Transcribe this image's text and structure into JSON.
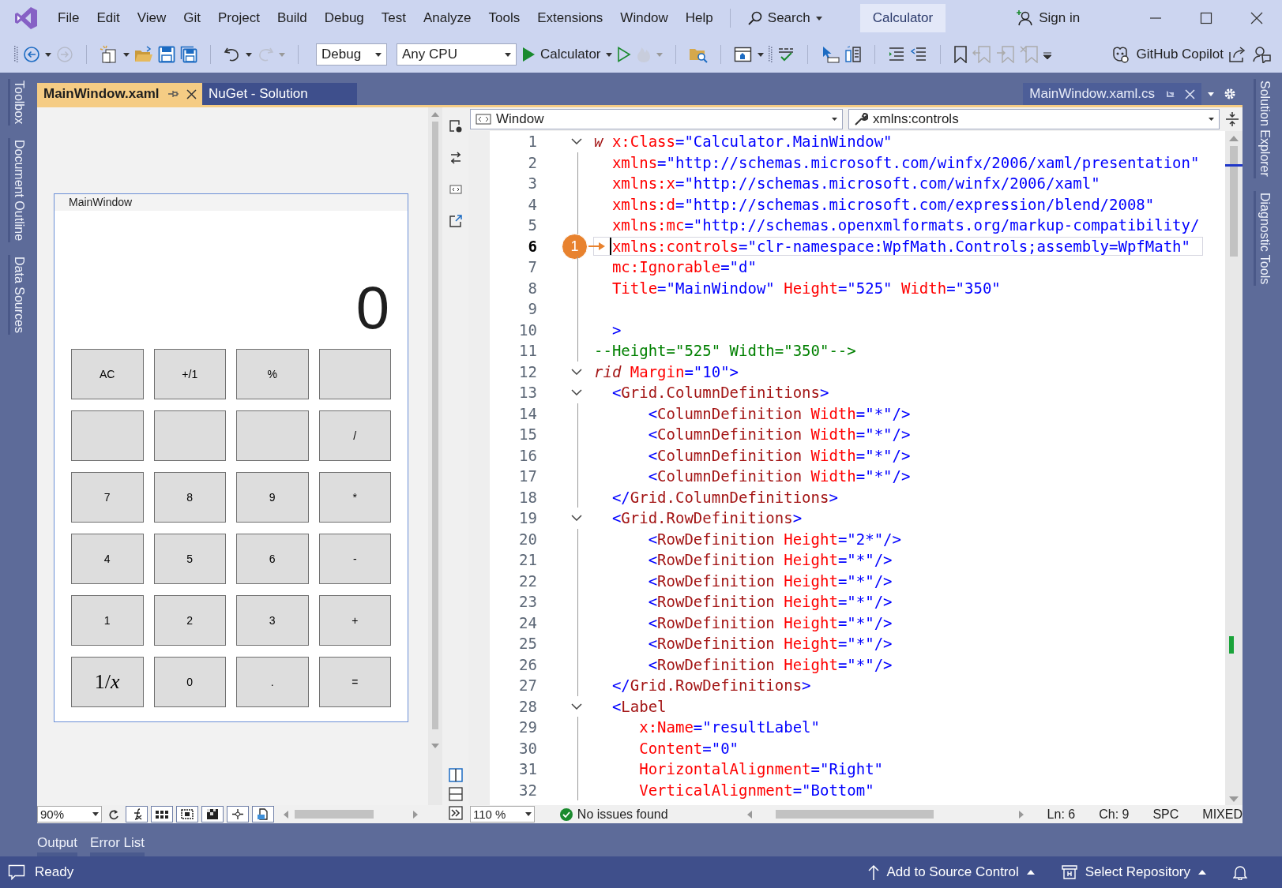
{
  "window": {
    "badge": "Calculator"
  },
  "menu": [
    "File",
    "Edit",
    "View",
    "Git",
    "Project",
    "Build",
    "Debug",
    "Test",
    "Analyze",
    "Tools",
    "Extensions",
    "Window",
    "Help"
  ],
  "search": {
    "label": "Search"
  },
  "account": {
    "label": "Sign in"
  },
  "toolbar": {
    "configuration": "Debug",
    "platform": "Any CPU",
    "start_target": "Calculator",
    "copilot": "GitHub Copilot"
  },
  "left_tool_tabs": [
    "Toolbox",
    "Document Outline",
    "Data Sources"
  ],
  "right_tool_tabs": [
    "Solution Explorer",
    "Diagnostic Tools"
  ],
  "document_tabs": [
    {
      "label": "MainWindow.xaml",
      "selected": true
    },
    {
      "label": "NuGet - Solution",
      "selected": false
    }
  ],
  "preview_tab": {
    "label": "MainWindow.xaml.cs"
  },
  "designer": {
    "window_title": "MainWindow",
    "display": "0",
    "zoom": "90%",
    "buttons": [
      {
        "kind": "text",
        "label": "AC"
      },
      {
        "kind": "text",
        "label": "+/1"
      },
      {
        "kind": "text",
        "label": "%"
      },
      {
        "kind": "blank"
      },
      {
        "kind": "blank"
      },
      {
        "kind": "blank"
      },
      {
        "kind": "blank"
      },
      {
        "kind": "text",
        "label": "/"
      },
      {
        "kind": "text",
        "label": "7"
      },
      {
        "kind": "text",
        "label": "8"
      },
      {
        "kind": "text",
        "label": "9"
      },
      {
        "kind": "text",
        "label": "*"
      },
      {
        "kind": "text",
        "label": "4"
      },
      {
        "kind": "text",
        "label": "5"
      },
      {
        "kind": "text",
        "label": "6"
      },
      {
        "kind": "text",
        "label": "-"
      },
      {
        "kind": "text",
        "label": "1"
      },
      {
        "kind": "text",
        "label": "2"
      },
      {
        "kind": "text",
        "label": "3"
      },
      {
        "kind": "text",
        "label": "+"
      },
      {
        "kind": "math",
        "label": "1/*x*"
      },
      {
        "kind": "text",
        "label": "0"
      },
      {
        "kind": "text",
        "label": "."
      },
      {
        "kind": "text",
        "label": "="
      }
    ]
  },
  "editor": {
    "type_combo": "Window",
    "member_combo": "xmlns:controls",
    "callout": "1",
    "zoom": "110 %",
    "issues": "No issues found",
    "line": "Ln: 6",
    "column": "Ch: 9",
    "whitespace": "SPC",
    "line_endings": "MIXED",
    "lines": [
      {
        "number": "1",
        "foldable": true,
        "current": false,
        "segments": [
          {
            "kind": "tag",
            "text": "w"
          },
          {
            "kind": "attr",
            "text": " x:Class"
          },
          {
            "kind": "value",
            "text": "=\"Calculator.MainWindow\""
          }
        ]
      },
      {
        "number": "2",
        "foldable": false,
        "current": false,
        "segments": [
          {
            "kind": "attr",
            "text": "  xmlns"
          },
          {
            "kind": "value",
            "text": "=\"http://schemas.microsoft.com/winfx/2006/xaml/presentation\""
          }
        ]
      },
      {
        "number": "3",
        "foldable": false,
        "current": false,
        "segments": [
          {
            "kind": "attr",
            "text": "  xmlns:x"
          },
          {
            "kind": "value",
            "text": "=\"http://schemas.microsoft.com/winfx/2006/xaml\""
          }
        ]
      },
      {
        "number": "4",
        "foldable": false,
        "current": false,
        "segments": [
          {
            "kind": "attr",
            "text": "  xmlns:d"
          },
          {
            "kind": "value",
            "text": "=\"http://schemas.microsoft.com/expression/blend/2008\""
          }
        ]
      },
      {
        "number": "5",
        "foldable": false,
        "current": false,
        "segments": [
          {
            "kind": "attr",
            "text": "  xmlns:mc"
          },
          {
            "kind": "value",
            "text": "=\"http://schemas.openxmlformats.org/markup-compatibility/"
          }
        ]
      },
      {
        "number": "6",
        "foldable": false,
        "current": true,
        "segments": [
          {
            "kind": "attr",
            "text": "  xmlns:controls"
          },
          {
            "kind": "value",
            "text": "=\"clr-namespace:WpfMath.Controls;assembly=WpfMath\""
          }
        ]
      },
      {
        "number": "7",
        "foldable": false,
        "current": false,
        "segments": [
          {
            "kind": "attr",
            "text": "  mc:Ignorable"
          },
          {
            "kind": "value",
            "text": "=\"d\""
          }
        ]
      },
      {
        "number": "8",
        "foldable": false,
        "current": false,
        "segments": [
          {
            "kind": "attr",
            "text": "  Title"
          },
          {
            "kind": "value",
            "text": "=\"MainWindow\""
          },
          {
            "kind": "attr",
            "text": " Height"
          },
          {
            "kind": "value",
            "text": "=\"525\""
          },
          {
            "kind": "attr",
            "text": " Width"
          },
          {
            "kind": "value",
            "text": "=\"350\""
          }
        ]
      },
      {
        "number": "9",
        "foldable": false,
        "current": false
      },
      {
        "number": "10",
        "foldable": false,
        "current": false,
        "segments": [
          {
            "kind": "punct",
            "text": "  >"
          }
        ]
      },
      {
        "number": "11",
        "foldable": false,
        "current": false,
        "segments": [
          {
            "kind": "comment",
            "text": "--Height=\"525\" Width=\"350\"-->"
          }
        ]
      },
      {
        "number": "12",
        "foldable": true,
        "current": false,
        "segments": [
          {
            "kind": "tag",
            "text": "rid"
          },
          {
            "kind": "attr",
            "text": " Margin"
          },
          {
            "kind": "value",
            "text": "=\"10\""
          },
          {
            "kind": "punct",
            "text": ">"
          }
        ]
      },
      {
        "number": "13",
        "foldable": true,
        "current": false,
        "segments": [
          {
            "kind": "punct",
            "text": "  <"
          },
          {
            "kind": "tag",
            "text": "Grid.ColumnDefinitions"
          },
          {
            "kind": "punct",
            "text": ">"
          }
        ]
      },
      {
        "number": "14",
        "foldable": false,
        "current": false,
        "segments": [
          {
            "kind": "punct",
            "text": "      <"
          },
          {
            "kind": "tag",
            "text": "ColumnDefinition"
          },
          {
            "kind": "attr",
            "text": " Width"
          },
          {
            "kind": "value",
            "text": "=\"*\""
          },
          {
            "kind": "punct",
            "text": "/>"
          }
        ]
      },
      {
        "number": "15",
        "foldable": false,
        "current": false,
        "segments": [
          {
            "kind": "punct",
            "text": "      <"
          },
          {
            "kind": "tag",
            "text": "ColumnDefinition"
          },
          {
            "kind": "attr",
            "text": " Width"
          },
          {
            "kind": "value",
            "text": "=\"*\""
          },
          {
            "kind": "punct",
            "text": "/>"
          }
        ]
      },
      {
        "number": "16",
        "foldable": false,
        "current": false,
        "segments": [
          {
            "kind": "punct",
            "text": "      <"
          },
          {
            "kind": "tag",
            "text": "ColumnDefinition"
          },
          {
            "kind": "attr",
            "text": " Width"
          },
          {
            "kind": "value",
            "text": "=\"*\""
          },
          {
            "kind": "punct",
            "text": "/>"
          }
        ]
      },
      {
        "number": "17",
        "foldable": false,
        "current": false,
        "segments": [
          {
            "kind": "punct",
            "text": "      <"
          },
          {
            "kind": "tag",
            "text": "ColumnDefinition"
          },
          {
            "kind": "attr",
            "text": " Width"
          },
          {
            "kind": "value",
            "text": "=\"*\""
          },
          {
            "kind": "punct",
            "text": "/>"
          }
        ]
      },
      {
        "number": "18",
        "foldable": false,
        "current": false,
        "segments": [
          {
            "kind": "punct",
            "text": "  </"
          },
          {
            "kind": "tag",
            "text": "Grid.ColumnDefinitions"
          },
          {
            "kind": "punct",
            "text": ">"
          }
        ]
      },
      {
        "number": "19",
        "foldable": true,
        "current": false,
        "segments": [
          {
            "kind": "punct",
            "text": "  <"
          },
          {
            "kind": "tag",
            "text": "Grid.RowDefinitions"
          },
          {
            "kind": "punct",
            "text": ">"
          }
        ]
      },
      {
        "number": "20",
        "foldable": false,
        "current": false,
        "segments": [
          {
            "kind": "punct",
            "text": "      <"
          },
          {
            "kind": "tag",
            "text": "RowDefinition"
          },
          {
            "kind": "attr",
            "text": " Height"
          },
          {
            "kind": "value",
            "text": "=\"2*\""
          },
          {
            "kind": "punct",
            "text": "/>"
          }
        ]
      },
      {
        "number": "21",
        "foldable": false,
        "current": false,
        "segments": [
          {
            "kind": "punct",
            "text": "      <"
          },
          {
            "kind": "tag",
            "text": "RowDefinition"
          },
          {
            "kind": "attr",
            "text": " Height"
          },
          {
            "kind": "value",
            "text": "=\"*\""
          },
          {
            "kind": "punct",
            "text": "/>"
          }
        ]
      },
      {
        "number": "22",
        "foldable": false,
        "current": false,
        "segments": [
          {
            "kind": "punct",
            "text": "      <"
          },
          {
            "kind": "tag",
            "text": "RowDefinition"
          },
          {
            "kind": "attr",
            "text": " Height"
          },
          {
            "kind": "value",
            "text": "=\"*\""
          },
          {
            "kind": "punct",
            "text": "/>"
          }
        ]
      },
      {
        "number": "23",
        "foldable": false,
        "current": false,
        "segments": [
          {
            "kind": "punct",
            "text": "      <"
          },
          {
            "kind": "tag",
            "text": "RowDefinition"
          },
          {
            "kind": "attr",
            "text": " Height"
          },
          {
            "kind": "value",
            "text": "=\"*\""
          },
          {
            "kind": "punct",
            "text": "/>"
          }
        ]
      },
      {
        "number": "24",
        "foldable": false,
        "current": false,
        "segments": [
          {
            "kind": "punct",
            "text": "      <"
          },
          {
            "kind": "tag",
            "text": "RowDefinition"
          },
          {
            "kind": "attr",
            "text": " Height"
          },
          {
            "kind": "value",
            "text": "=\"*\""
          },
          {
            "kind": "punct",
            "text": "/>"
          }
        ]
      },
      {
        "number": "25",
        "foldable": false,
        "current": false,
        "segments": [
          {
            "kind": "punct",
            "text": "      <"
          },
          {
            "kind": "tag",
            "text": "RowDefinition"
          },
          {
            "kind": "attr",
            "text": " Height"
          },
          {
            "kind": "value",
            "text": "=\"*\""
          },
          {
            "kind": "punct",
            "text": "/>"
          }
        ]
      },
      {
        "number": "26",
        "foldable": false,
        "current": false,
        "segments": [
          {
            "kind": "punct",
            "text": "      <"
          },
          {
            "kind": "tag",
            "text": "RowDefinition"
          },
          {
            "kind": "attr",
            "text": " Height"
          },
          {
            "kind": "value",
            "text": "=\"*\""
          },
          {
            "kind": "punct",
            "text": "/>"
          }
        ]
      },
      {
        "number": "27",
        "foldable": false,
        "current": false,
        "segments": [
          {
            "kind": "punct",
            "text": "  </"
          },
          {
            "kind": "tag",
            "text": "Grid.RowDefinitions"
          },
          {
            "kind": "punct",
            "text": ">"
          }
        ]
      },
      {
        "number": "28",
        "foldable": true,
        "current": false,
        "segments": [
          {
            "kind": "punct",
            "text": "  <"
          },
          {
            "kind": "tag",
            "text": "Label"
          }
        ]
      },
      {
        "number": "29",
        "foldable": false,
        "current": false,
        "segments": [
          {
            "kind": "attr",
            "text": "     x:Name"
          },
          {
            "kind": "value",
            "text": "=\"resultLabel\""
          }
        ]
      },
      {
        "number": "30",
        "foldable": false,
        "current": false,
        "segments": [
          {
            "kind": "attr",
            "text": "     Content"
          },
          {
            "kind": "value",
            "text": "=\"0\""
          }
        ]
      },
      {
        "number": "31",
        "foldable": false,
        "current": false,
        "segments": [
          {
            "kind": "attr",
            "text": "     HorizontalAlignment"
          },
          {
            "kind": "value",
            "text": "=\"Right\""
          }
        ]
      },
      {
        "number": "32",
        "foldable": false,
        "current": false,
        "segments": [
          {
            "kind": "attr",
            "text": "     VerticalAlignment"
          },
          {
            "kind": "value",
            "text": "=\"Bottom\""
          }
        ]
      }
    ]
  },
  "bottom_tabs": [
    "Output",
    "Error List"
  ],
  "status_bar": {
    "text": "Ready",
    "source_control": "Add to Source Control",
    "repository": "Select Repository"
  }
}
